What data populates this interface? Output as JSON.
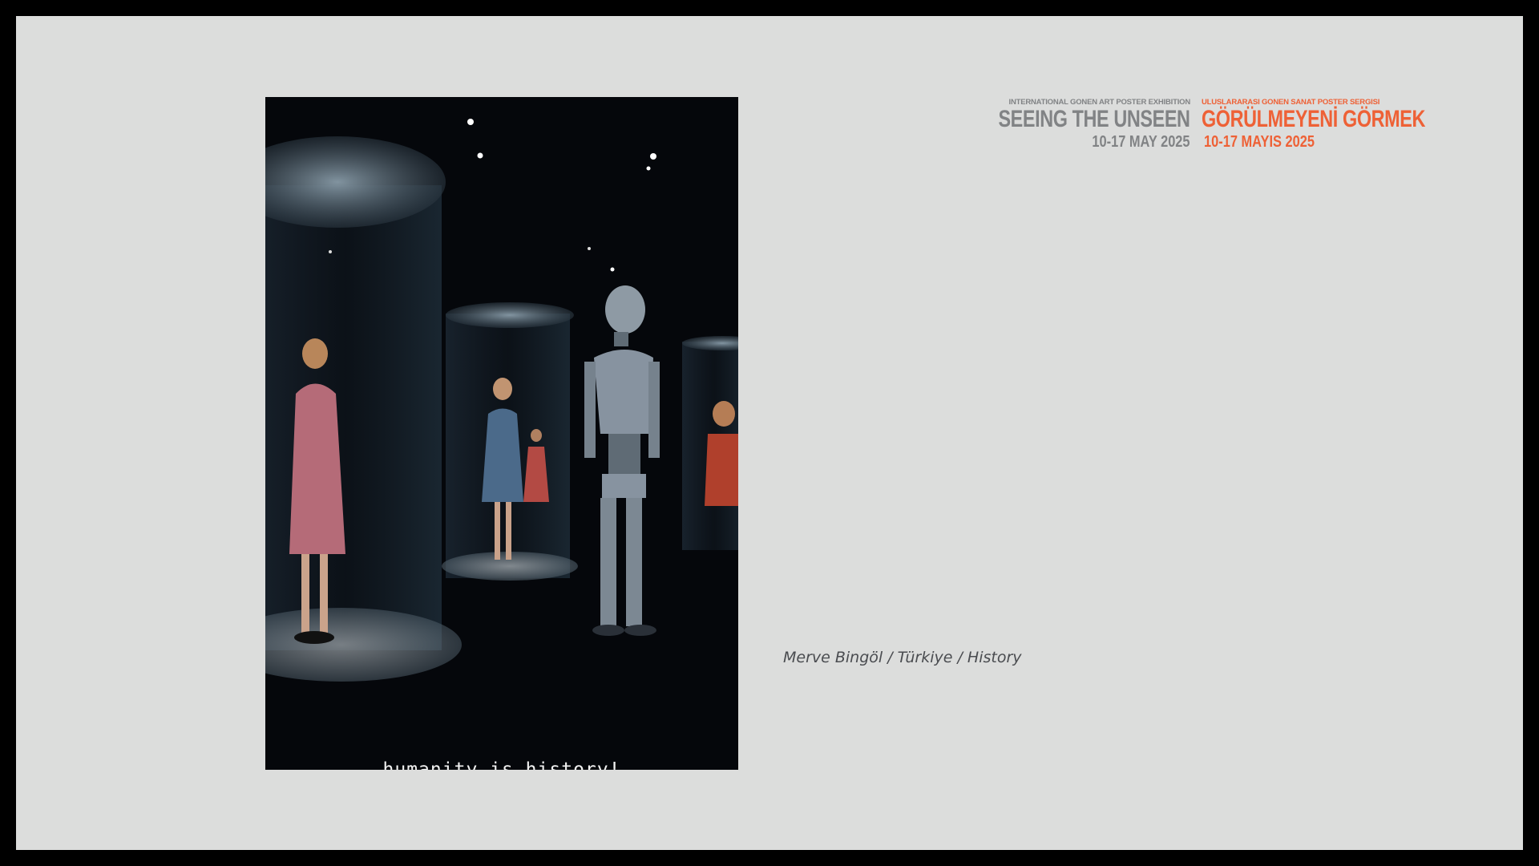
{
  "header": {
    "en_subtitle": "INTERNATIONAL GONEN ART POSTER EXHIBITION",
    "en_title": "SEEING THE UNSEEN",
    "en_dates": "10-17 MAY 2025",
    "tr_subtitle": "ULUSLARARASI GONEN SANAT POSTER SERGISI",
    "tr_title": "GÖRÜLMEYENİ GÖRMEK",
    "tr_dates": "10-17 MAYIS 2025"
  },
  "poster": {
    "caption": "humanity is history!"
  },
  "credit": "Merve Bingöl / Türkiye / History",
  "colors": {
    "frame": "#000000",
    "background": "#dcdddc",
    "accent_orange": "#ee6136",
    "title_grey": "#818385"
  }
}
